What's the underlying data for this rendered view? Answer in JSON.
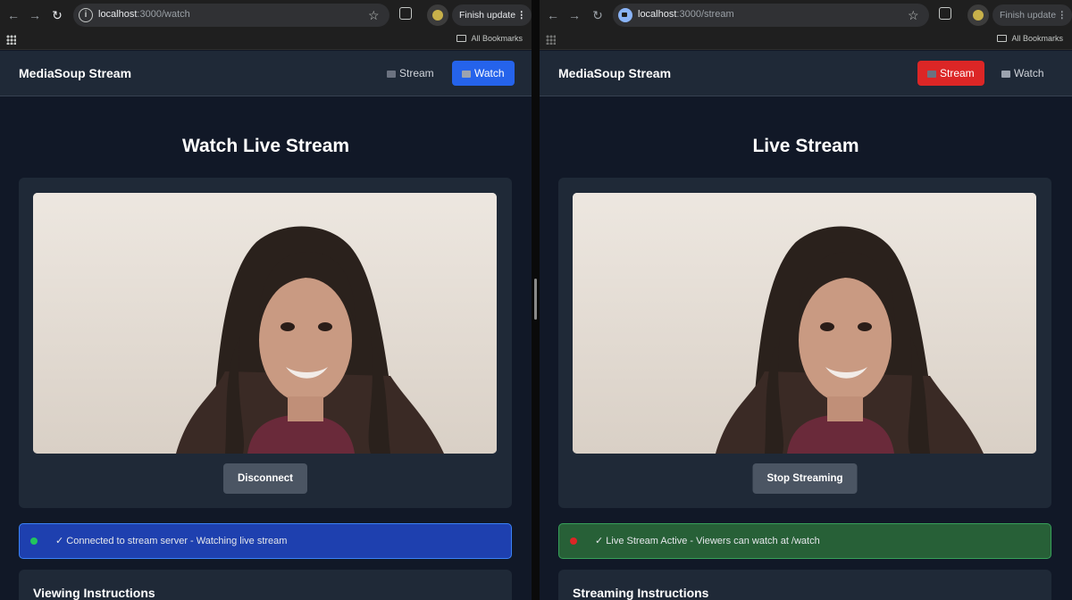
{
  "left_window": {
    "url_host": "localhost",
    "url_path": ":3000/watch",
    "update_button": "Finish update",
    "bookmarks_label": "All Bookmarks",
    "app": {
      "brand": "MediaSoup Stream",
      "nav_stream": "Stream",
      "nav_watch": "Watch",
      "title": "Watch Live Stream",
      "action_button": "Disconnect",
      "status_text": "✓ Connected to stream server - Watching live stream",
      "instructions_title": "Viewing Instructions"
    }
  },
  "right_window": {
    "url_host": "localhost",
    "url_path": ":3000/stream",
    "update_button": "Finish update",
    "bookmarks_label": "All Bookmarks",
    "app": {
      "brand": "MediaSoup Stream",
      "nav_stream": "Stream",
      "nav_watch": "Watch",
      "title": "Live Stream",
      "action_button": "Stop Streaming",
      "status_text": "✓ Live Stream Active - Viewers can watch at /watch",
      "instructions_title": "Streaming Instructions"
    }
  },
  "colors": {
    "page_bg": "#111827",
    "card_bg": "#1f2937",
    "watch_active": "#2563eb",
    "stream_active": "#dc2626",
    "status_blue": "#1e40af",
    "status_green": "#276037"
  }
}
